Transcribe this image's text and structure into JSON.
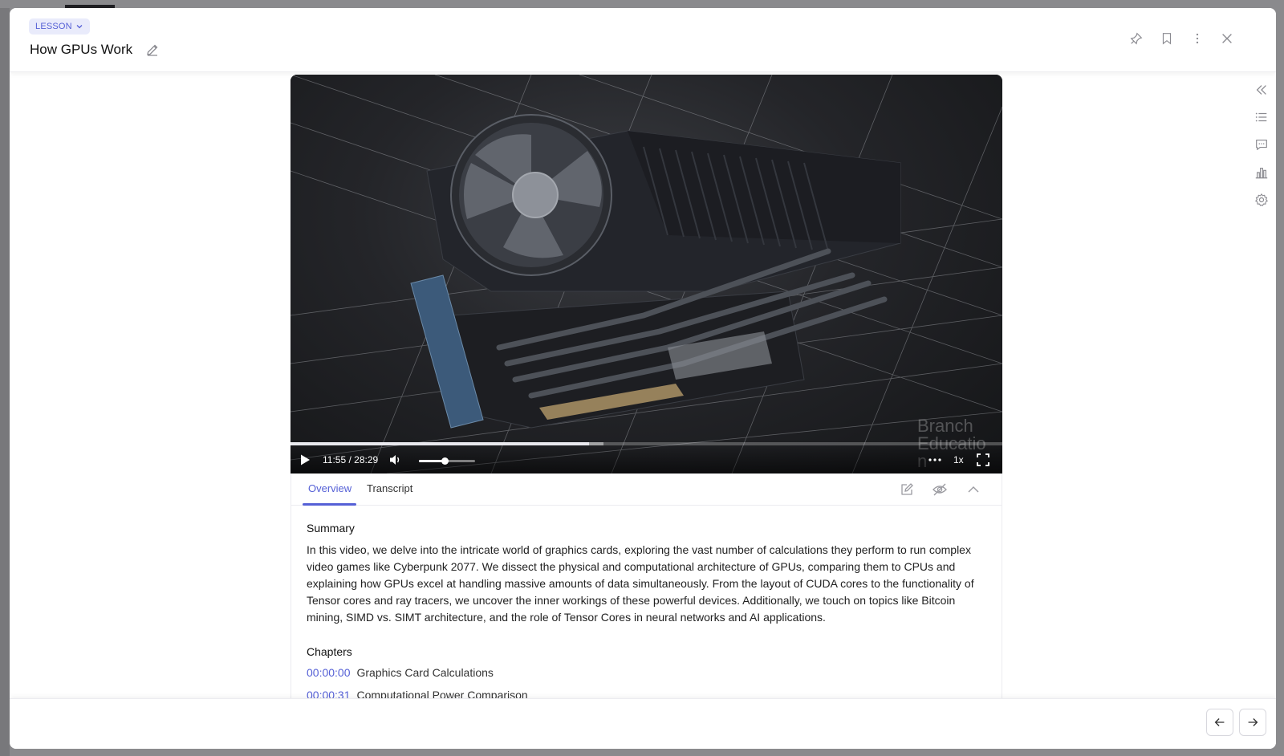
{
  "header": {
    "type_label": "LESSON",
    "title": "How GPUs Work"
  },
  "video": {
    "time_display": "11:55 / 28:29",
    "progress": 0.419,
    "buffered": 0.44,
    "volume": 0.45,
    "speed": "1x",
    "watermark": "Branch Education"
  },
  "tabs": [
    {
      "label": "Overview",
      "active": true
    },
    {
      "label": "Transcript",
      "active": false
    }
  ],
  "overview": {
    "summary_heading": "Summary",
    "summary_text": "In this video, we delve into the intricate world of graphics cards, exploring the vast number of calculations they perform to run complex video games like Cyberpunk 2077. We dissect the physical and computational architecture of GPUs, comparing them to CPUs and explaining how GPUs excel at handling massive amounts of data simultaneously. From the layout of CUDA cores to the functionality of Tensor cores and ray tracers, we uncover the inner workings of these powerful devices. Additionally, we touch on topics like Bitcoin mining, SIMD vs. SIMT architecture, and the role of Tensor Cores in neural networks and AI applications.",
    "chapters_heading": "Chapters",
    "chapters": [
      {
        "time": "00:00:00",
        "name": "Graphics Card Calculations"
      },
      {
        "time": "00:00:31",
        "name": "Computational Power Comparison"
      }
    ]
  },
  "colors": {
    "accent": "#5560d6",
    "chip_bg": "#e9ebfb"
  },
  "icons": {
    "header": [
      "sparkle-pin-icon",
      "bookmark-icon",
      "more-vertical-icon",
      "close-icon"
    ],
    "rail": [
      "collapse-left-icon",
      "list-icon",
      "chat-icon",
      "bar-chart-icon",
      "settings-icon"
    ],
    "footer": [
      "arrow-left-icon",
      "arrow-right-icon"
    ]
  }
}
